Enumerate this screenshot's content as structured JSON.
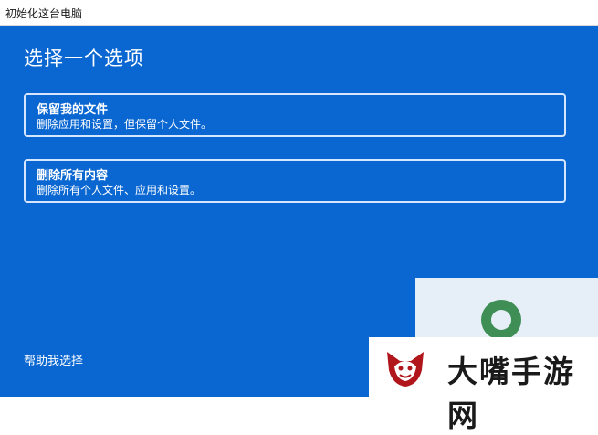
{
  "window": {
    "title": "初始化这台电脑"
  },
  "dialog": {
    "heading": "选择一个选项",
    "options": [
      {
        "label": "保留我的文件",
        "description": "删除应用和设置，但保留个人文件。"
      },
      {
        "label": "删除所有内容",
        "description": "删除所有个人文件、应用和设置。"
      }
    ],
    "help_link": "帮助我选择"
  },
  "watermark": {
    "text": "大嘴手游网",
    "logo_icon": "fox-head-logo-icon"
  },
  "colors": {
    "panel_bg": "#0a67d2",
    "option_border": "#d6e6ff",
    "watermark_red": "#b0161b"
  }
}
